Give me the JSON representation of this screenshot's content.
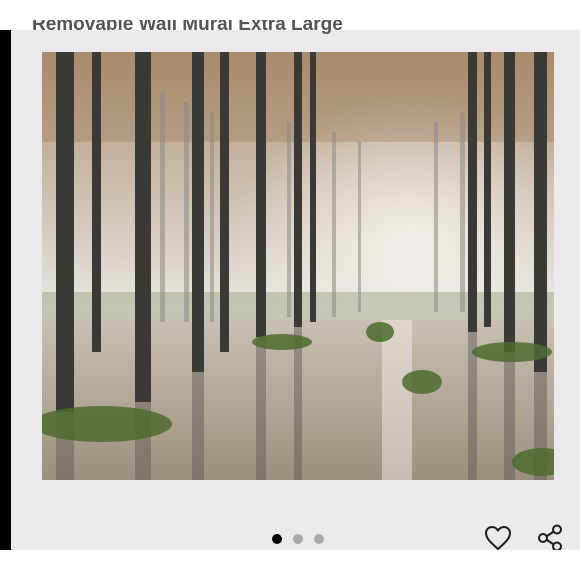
{
  "listing": {
    "title": "Removable Wall Mural Extra Large",
    "image_alt": "Misty poplar forest with reflections in flooded water"
  },
  "carousel": {
    "dots": [
      {
        "state": "active"
      },
      {
        "state": "inactive"
      },
      {
        "state": "inactive"
      }
    ]
  },
  "actions": [
    {
      "icon": "heart-icon",
      "label": "favorite"
    },
    {
      "icon": "share-icon",
      "label": "share"
    }
  ],
  "colors": {
    "card_background": "#ece9ec",
    "left_edge": "#000000",
    "dot_active": "#000000",
    "dot_inactive": "#a9a9a9"
  }
}
